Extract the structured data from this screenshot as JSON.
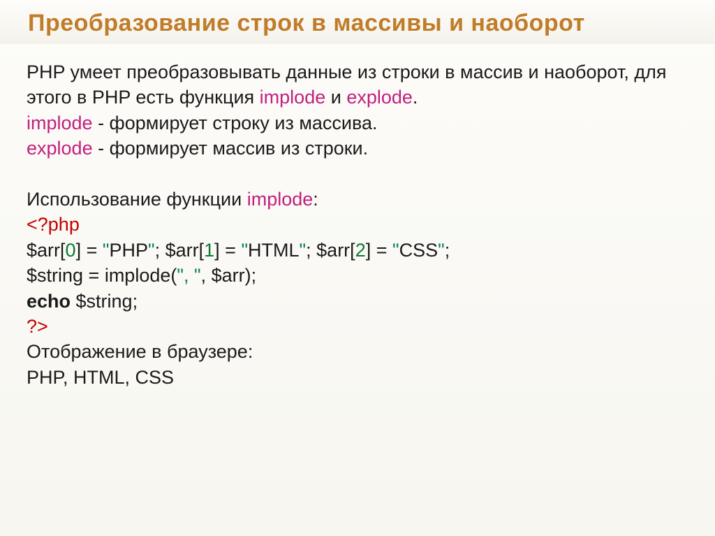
{
  "slide": {
    "title": "Преобразование строк в массивы и наоборот",
    "intro": {
      "line1_prefix": "PHP умеет преобразовывать данные из строки в массив и наоборот, для этого в PHP есть функция ",
      "implode_word": "implode",
      "and_word": " и ",
      "explode_word": "explode",
      "period": "."
    },
    "def_implode": {
      "name": "implode",
      "desc": " - формирует строку из массива."
    },
    "def_explode": {
      "name": "explode",
      "desc": " - формирует массив из строки."
    },
    "usage_label_prefix": "Использование функции ",
    "usage_label_func": "implode",
    "usage_label_colon": ":",
    "code": {
      "open_tag": "<?php",
      "arr_var": "$arr",
      "lb": "[",
      "rb": "]",
      "idx0": "0",
      "idx1": "1",
      "idx2": "2",
      "eq": " = ",
      "q": "\"",
      "val0": "PHP",
      "val1": "HTML",
      "val2": "CSS",
      "semi_sp": "; ",
      "semi": ";",
      "string_var": "$string",
      "implode_call_prefix": " = implode(",
      "comma_sep": ", ",
      "comma_quoted": "\", \"",
      "arr_close": ");",
      "echo_kw": "echo",
      "echo_arg": " $string;",
      "close_tag": "?>"
    },
    "browser_label": "Отображение в браузере:",
    "browser_output": "PHP,  HTML,  CSS"
  }
}
